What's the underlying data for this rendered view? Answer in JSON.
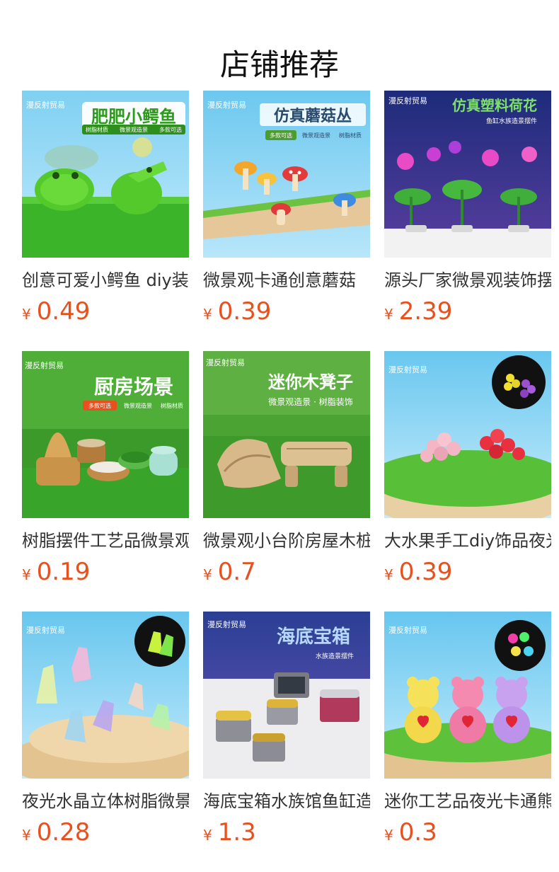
{
  "page": {
    "title": "店铺推荐"
  },
  "colors": {
    "price": "#e8501e",
    "text": "#333333",
    "title": "#111111"
  },
  "products": [
    {
      "name": "创意可爱小鳄鱼 diy装饰摆件",
      "currency": "¥",
      "price": "0.49",
      "image": {
        "brand": "漫反射贸易",
        "headline": "肥肥小鳄鱼",
        "tags": [
          "树脂材质",
          "微景观造景",
          "多款可选"
        ],
        "subject": "green-crocodile-figurines"
      }
    },
    {
      "name": "微景观卡通创意蘑菇",
      "currency": "¥",
      "price": "0.39",
      "image": {
        "brand": "漫反射贸易",
        "headline": "仿真蘑菇丛",
        "tags": [
          "多款可选",
          "微景观造景",
          "树脂材质"
        ],
        "subject": "mushroom-figurines"
      }
    },
    {
      "name": "源头厂家微景观装饰摆件",
      "currency": "¥",
      "price": "2.39",
      "image": {
        "brand": "漫反射贸易",
        "headline": "仿真塑料荷花",
        "tags": [
          "鱼缸水族造景摆件"
        ],
        "subject": "plastic-lotus-aquarium"
      }
    },
    {
      "name": "树脂摆件工艺品微景观厨房",
      "currency": "¥",
      "price": "0.19",
      "image": {
        "brand": "漫反射贸易",
        "headline": "厨房场景",
        "tags": [
          "多款可选",
          "微景观造景",
          "树脂材质"
        ],
        "subject": "kitchen-miniatures"
      }
    },
    {
      "name": "微景观小台阶房屋木桩",
      "currency": "¥",
      "price": "0.7",
      "image": {
        "brand": "漫反射贸易",
        "headline": "迷你木凳子",
        "tags": [
          "微景观造景 · 树脂装饰"
        ],
        "subject": "wooden-bench-miniatures"
      }
    },
    {
      "name": "大水果手工diy饰品夜光",
      "currency": "¥",
      "price": "0.39",
      "image": {
        "brand": "漫反射贸易",
        "headline": "",
        "tags": [],
        "subject": "glowing-grapes"
      }
    },
    {
      "name": "夜光水晶立体树脂微景观",
      "currency": "¥",
      "price": "0.28",
      "image": {
        "brand": "漫反射贸易",
        "headline": "",
        "tags": [],
        "subject": "glowing-crystals"
      }
    },
    {
      "name": "海底宝箱水族馆鱼缸造景",
      "currency": "¥",
      "price": "1.3",
      "image": {
        "brand": "漫反射贸易",
        "headline": "海底宝箱",
        "tags": [
          "水族造景摆件"
        ],
        "subject": "treasure-chests"
      }
    },
    {
      "name": "迷你工艺品夜光卡通熊",
      "currency": "¥",
      "price": "0.3",
      "image": {
        "brand": "漫反射贸易",
        "headline": "",
        "tags": [],
        "subject": "glowing-bears"
      }
    }
  ]
}
